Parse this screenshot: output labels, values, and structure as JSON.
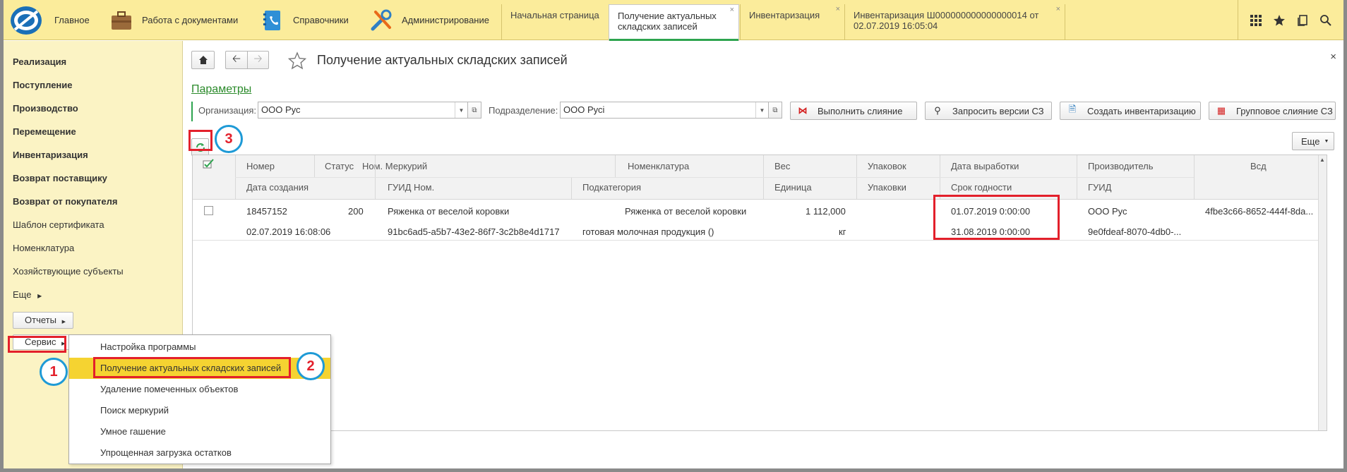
{
  "app": {
    "sections": [
      {
        "label": "Главное",
        "icon": "app-logo-icon"
      },
      {
        "label": "Работа с документами",
        "icon": "briefcase-icon"
      },
      {
        "label": "Справочники",
        "icon": "phonebook-icon"
      },
      {
        "label": "Администрирование",
        "icon": "tools-icon"
      }
    ],
    "tabs": [
      {
        "label": "Начальная страница",
        "closable": false
      },
      {
        "label_line1": "Получение актуальных",
        "label_line2": "складских записей",
        "active": true
      },
      {
        "label": "Инвентаризация"
      },
      {
        "label_line1": "Инвентаризация Ш000000000000000014 от",
        "label_line2": "02.07.2019 16:05:04"
      }
    ],
    "close_glyph": "×",
    "tool_icons": [
      "grid-icon",
      "star-icon",
      "history-icon",
      "search-icon"
    ]
  },
  "sidebar": {
    "items": [
      {
        "label": "Реализация",
        "bold": true
      },
      {
        "label": "Поступление",
        "bold": true
      },
      {
        "label": "Производство",
        "bold": true
      },
      {
        "label": "Перемещение",
        "bold": true
      },
      {
        "label": "Инвентаризация",
        "bold": true
      },
      {
        "label": "Возврат поставщику",
        "bold": true
      },
      {
        "label": "Возврат от покупателя",
        "bold": true
      },
      {
        "label": "Шаблон сертификата",
        "bold": false
      },
      {
        "label": "Номенклатура",
        "bold": false
      },
      {
        "label": "Хозяйствующие субъекты",
        "bold": false
      }
    ],
    "more_label": "Еще",
    "reports_label": "Отчеты",
    "service_label": "Сервис"
  },
  "service_menu": {
    "items": [
      "Настройка программы",
      "Получение актуальных складских записей",
      "Удаление помеченных объектов",
      "Поиск меркурий",
      "Умное гашение",
      "Упрощенная загрузка остатков"
    ],
    "highlighted_index": 1
  },
  "annotations": {
    "b1": "1",
    "b2": "2",
    "b3": "3"
  },
  "form": {
    "title": "Получение актуальных складских записей",
    "params_link": "Параметры",
    "org_label": "Организация:",
    "org_value": "ООО Рус",
    "dept_label": "Подразделение:",
    "dept_value": "ООО Русі",
    "buttons": {
      "merge": "Выполнить слияние",
      "request_versions": "Запросить версии СЗ",
      "create_inventory": "Создать инвентаризацию",
      "group_merge": "Групповое слияние СЗ",
      "more": "Еще"
    }
  },
  "table": {
    "header_row1": [
      "Номер",
      "Статус",
      "Ном. Меркурий",
      "Номенклатура",
      "Вес",
      "Упаковок",
      "Дата выработки",
      "Производитель",
      "Всд"
    ],
    "header_row2": [
      "Дата создания",
      "ГУИД Ном.",
      "Подкатегория",
      "Единица",
      "Упаковки",
      "Срок годности",
      "ГУИД"
    ],
    "rows": [
      {
        "number": "18457152",
        "status": "200",
        "merc_name": "Ряженка от веселой коровки",
        "nomenclature": "Ряженка от веселой коровки",
        "weight": "1 112,000",
        "packages": "",
        "prod_date": "01.07.2019 0:00:00",
        "producer": "ООО Рус",
        "vsd": "4fbe3c66-8652-444f-8da...",
        "created": "02.07.2019 16:08:06",
        "guid_nom": "91bc6ad5-a5b7-43e2-86f7-3c2b8e4d1717",
        "subcategory": "готовая молочная продукция ()",
        "unit": "кг",
        "packaging": "",
        "expiry": "31.08.2019 0:00:00",
        "guid": "9e0fdeaf-8070-4db0-..."
      }
    ]
  },
  "colors": {
    "top_bar": "#fbec9b",
    "sidebar": "#fbf3c4",
    "highlight": "#f5d331",
    "annotation_red": "#e3202b",
    "annotation_blue": "#1e9ad6",
    "link_green": "#2a8a2a"
  }
}
